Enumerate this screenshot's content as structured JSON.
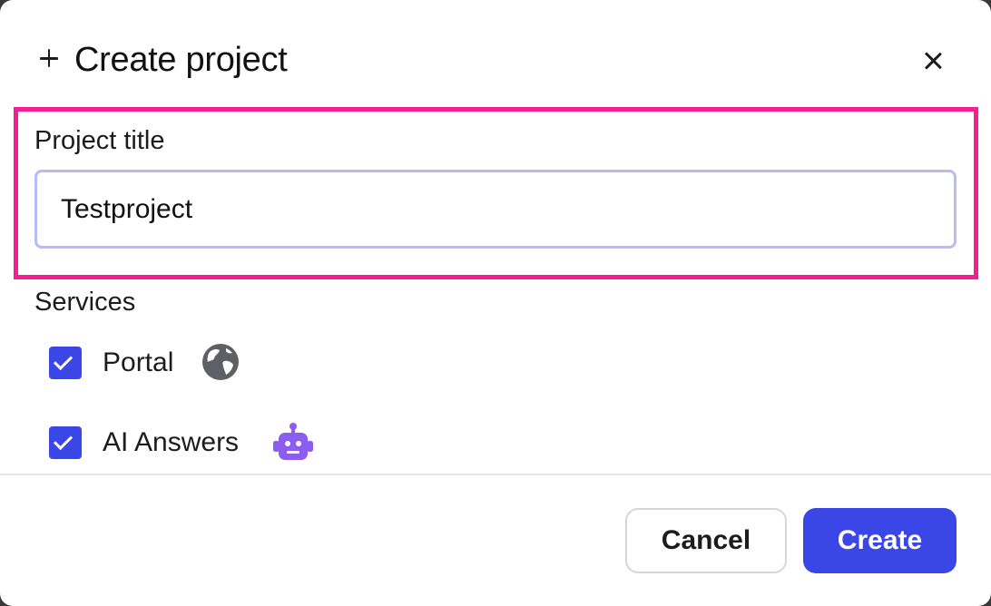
{
  "dialog": {
    "title": "Create project",
    "icons": {
      "title": "plus-icon",
      "close": "close-icon"
    }
  },
  "project_title": {
    "label": "Project title",
    "value": "Testproject"
  },
  "services": {
    "label": "Services",
    "items": [
      {
        "name": "Portal",
        "checked": true,
        "icon": "globe-icon"
      },
      {
        "name": "AI Answers",
        "checked": true,
        "icon": "robot-icon"
      }
    ]
  },
  "footer": {
    "cancel_label": "Cancel",
    "create_label": "Create"
  },
  "colors": {
    "accent": "#3b46e6",
    "highlight": "#f51f92",
    "input_border": "#b7bbf6",
    "robot": "#8d5cf0",
    "globe": "#5f5f66"
  }
}
